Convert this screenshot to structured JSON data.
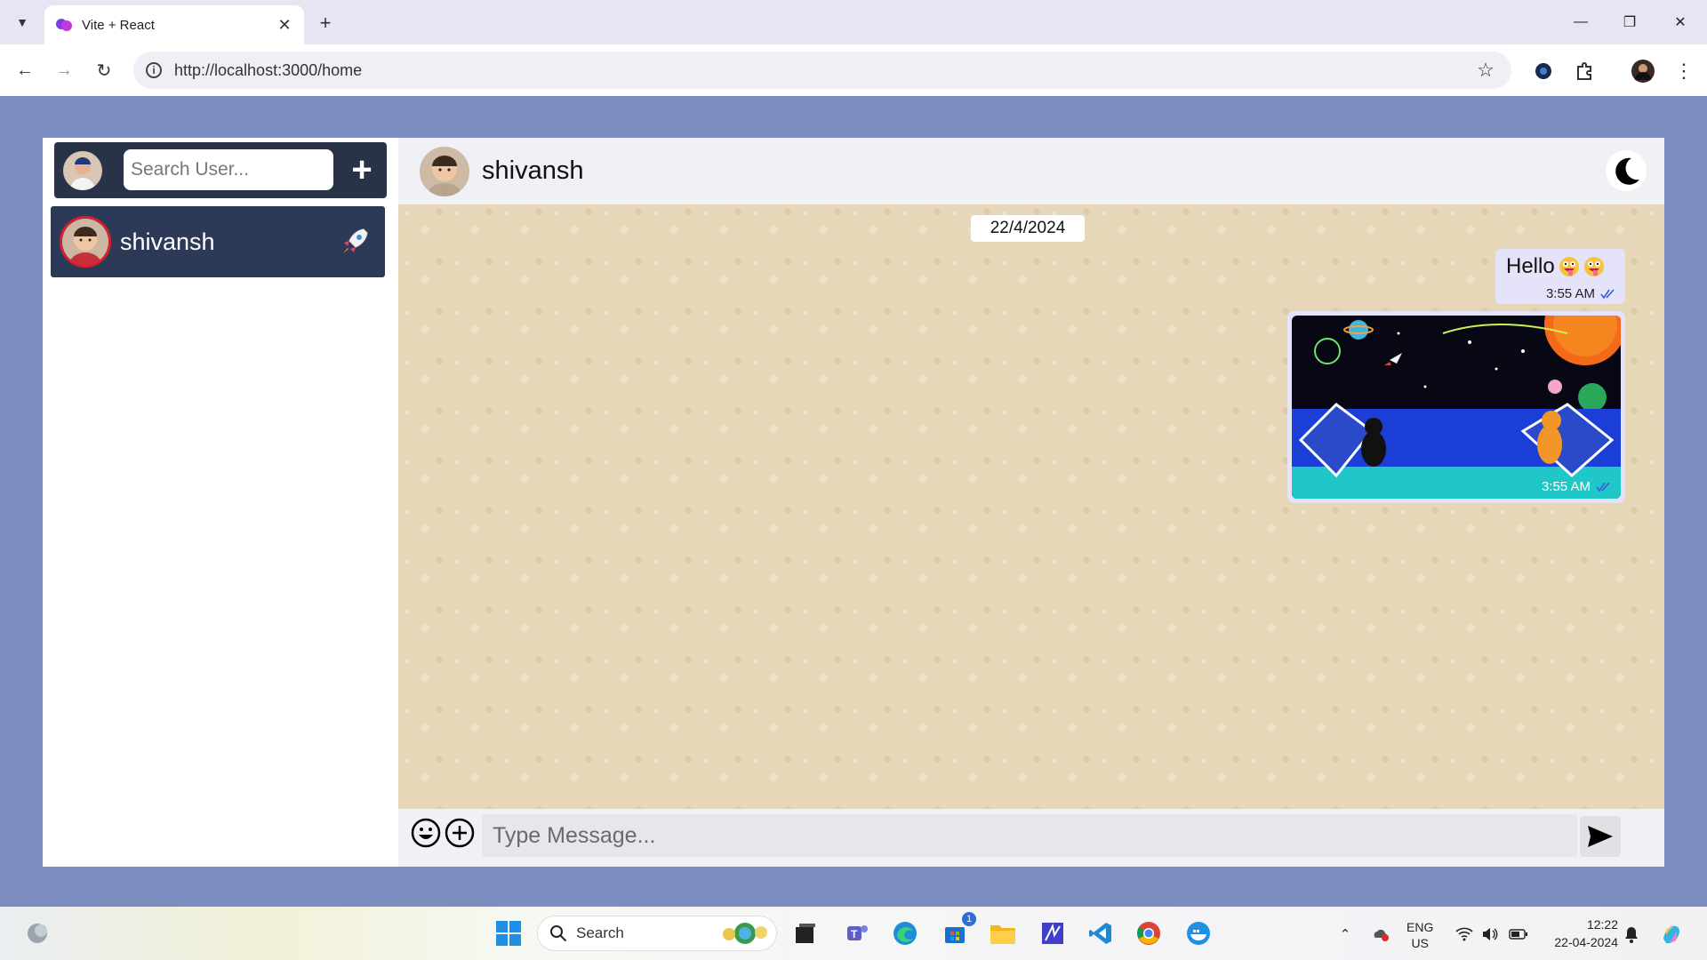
{
  "browser": {
    "tab_title": "Vite + React",
    "url": "http://localhost:3000/home"
  },
  "sidebar": {
    "search_placeholder": "Search User...",
    "contacts": [
      {
        "name": "shivansh"
      }
    ]
  },
  "chat": {
    "contact_name": "shivansh",
    "date_chip": "22/4/2024",
    "messages": [
      {
        "type": "text",
        "text": "Hello",
        "time": "3:55 AM"
      },
      {
        "type": "image",
        "time": "3:55 AM"
      }
    ],
    "composer_placeholder": "Type Message..."
  },
  "taskbar": {
    "search_label": "Search",
    "store_badge": "1",
    "lang_line1": "ENG",
    "lang_line2": "US",
    "time": "12:22",
    "date": "22-04-2024"
  },
  "colors": {
    "page_bg": "#7c8ec0",
    "sidebar_header": "#283348",
    "contact_active": "#2c3a57",
    "chat_wallpaper": "#e6d7b9",
    "bubble": "#e4e3fa",
    "read_tick": "#3b5bd6"
  }
}
